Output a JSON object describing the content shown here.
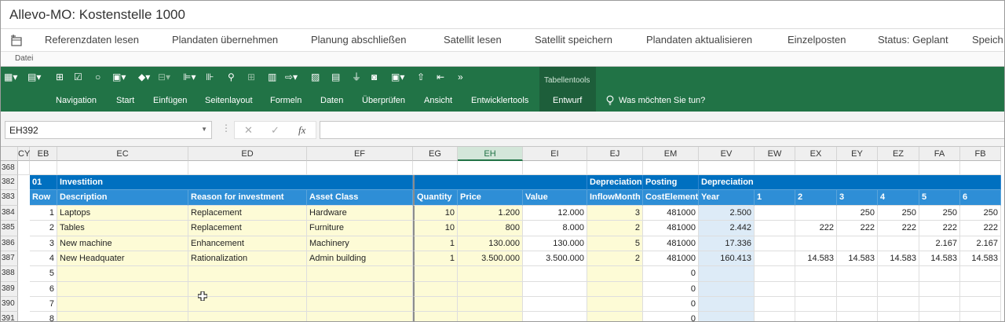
{
  "window": {
    "title": "Allevo-MO: Kostenstelle 1000"
  },
  "menu": {
    "items": [
      "Referenzdaten lesen",
      "Plandaten übernehmen",
      "Planung abschließen",
      "Satellit lesen",
      "Satellit speichern",
      "Plandaten aktualisieren",
      "Einzelposten",
      "Status: Geplant",
      "Speich"
    ],
    "group_label": "Datei"
  },
  "ribbon": {
    "tabs": [
      "Navigation",
      "Start",
      "Einfügen",
      "Seitenlayout",
      "Formeln",
      "Daten",
      "Überprüfen",
      "Ansicht",
      "Entwicklertools"
    ],
    "context_group": "Tabellentools",
    "context_tab": "Entwurf",
    "tellme": "Was möchten Sie tun?",
    "brand_color": "#217346"
  },
  "formula_bar": {
    "name_box": "EH392",
    "cancel": "✕",
    "enter": "✓",
    "fx": "fx",
    "formula": ""
  },
  "columns": [
    "CY",
    "EB",
    "EC",
    "ED",
    "EF",
    "EG",
    "EH",
    "EI",
    "EJ",
    "EM",
    "EV",
    "EW",
    "EX",
    "EY",
    "EZ",
    "FA",
    "FB"
  ],
  "selected_column": "EH",
  "rows": {
    "numbers": [
      "368",
      "382",
      "383",
      "384",
      "385",
      "386",
      "387",
      "388",
      "389",
      "390",
      "391"
    ]
  },
  "section": {
    "id": "01",
    "title": "Investition",
    "depreciation": "Depreciation",
    "posting": "Posting",
    "depreciation2": "Depreciation"
  },
  "headers": {
    "row": "Row",
    "description": "Description",
    "reason": "Reason for investment",
    "asset_class": "Asset Class",
    "quantity": "Quantity",
    "price": "Price",
    "value": "Value",
    "inflow": "InflowMonth",
    "cost_element": "CostElement",
    "year": "Year",
    "m1": "1",
    "m2": "2",
    "m3": "3",
    "m4": "4",
    "m5": "5",
    "m6": "6"
  },
  "data_rows": [
    {
      "row": "1",
      "description": "Laptops",
      "reason": "Replacement",
      "asset_class": "Hardware",
      "quantity": "10",
      "price": "1.200",
      "value": "12.000",
      "inflow": "3",
      "cost_element": "481000",
      "year": "2.500",
      "m1": "",
      "m2": "",
      "m3": "250",
      "m4": "250",
      "m5": "250",
      "m6": "250"
    },
    {
      "row": "2",
      "description": "Tables",
      "reason": "Replacement",
      "asset_class": "Furniture",
      "quantity": "10",
      "price": "800",
      "value": "8.000",
      "inflow": "2",
      "cost_element": "481000",
      "year": "2.442",
      "m1": "",
      "m2": "222",
      "m3": "222",
      "m4": "222",
      "m5": "222",
      "m6": "222"
    },
    {
      "row": "3",
      "description": "New machine",
      "reason": "Enhancement",
      "asset_class": "Machinery",
      "quantity": "1",
      "price": "130.000",
      "value": "130.000",
      "inflow": "5",
      "cost_element": "481000",
      "year": "17.336",
      "m1": "",
      "m2": "",
      "m3": "",
      "m4": "",
      "m5": "2.167",
      "m6": "2.167"
    },
    {
      "row": "4",
      "description": "New Headquater",
      "reason": "Rationalization",
      "asset_class": "Admin building",
      "quantity": "1",
      "price": "3.500.000",
      "value": "3.500.000",
      "inflow": "2",
      "cost_element": "481000",
      "year": "160.413",
      "m1": "",
      "m2": "14.583",
      "m3": "14.583",
      "m4": "14.583",
      "m5": "14.583",
      "m6": "14.583"
    },
    {
      "row": "5",
      "description": "",
      "reason": "",
      "asset_class": "",
      "quantity": "",
      "price": "",
      "value": "",
      "inflow": "",
      "cost_element": "0",
      "year": "",
      "m1": "",
      "m2": "",
      "m3": "",
      "m4": "",
      "m5": "",
      "m6": ""
    },
    {
      "row": "6",
      "description": "",
      "reason": "",
      "asset_class": "",
      "quantity": "",
      "price": "",
      "value": "",
      "inflow": "",
      "cost_element": "0",
      "year": "",
      "m1": "",
      "m2": "",
      "m3": "",
      "m4": "",
      "m5": "",
      "m6": ""
    },
    {
      "row": "7",
      "description": "",
      "reason": "",
      "asset_class": "",
      "quantity": "",
      "price": "",
      "value": "",
      "inflow": "",
      "cost_element": "0",
      "year": "",
      "m1": "",
      "m2": "",
      "m3": "",
      "m4": "",
      "m5": "",
      "m6": ""
    },
    {
      "row": "8",
      "description": "",
      "reason": "",
      "asset_class": "",
      "quantity": "",
      "price": "",
      "value": "",
      "inflow": "",
      "cost_element": "0",
      "year": "",
      "m1": "",
      "m2": "",
      "m3": "",
      "m4": "",
      "m5": "",
      "m6": ""
    }
  ]
}
